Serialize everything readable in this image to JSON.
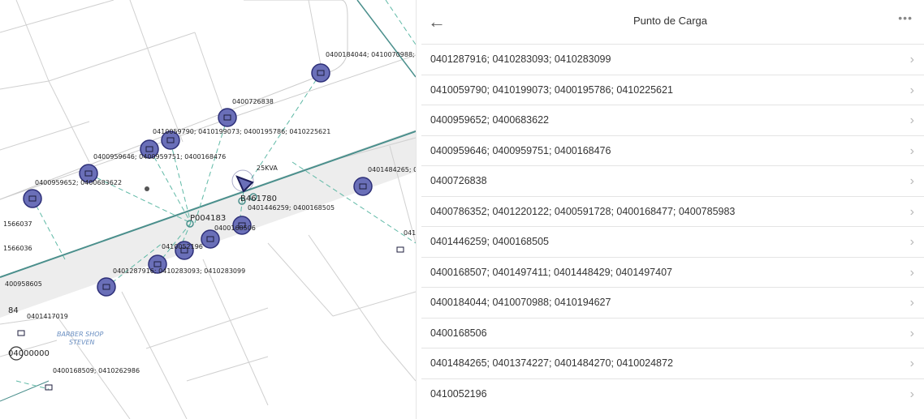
{
  "panel": {
    "title": "Punto de Carga",
    "back_icon": "arrow-left-icon",
    "menu_icon": "more-horizontal-icon",
    "items": [
      "0401287916; 0410283093; 0410283099",
      "0410059790; 0410199073; 0400195786; 0410225621",
      "0400959652; 0400683622",
      "0400959646; 0400959751; 0400168476",
      "0400726838",
      "0400786352; 0401220122; 0400591728; 0400168477; 0400785983",
      "0401446259; 0400168505",
      "0400168507; 0401497411; 0401448429; 0401497407",
      "0400184044; 0410070988; 0410194627",
      "0400168506",
      "0401484265; 0401374227; 0401484270; 0410024872",
      "0410052196"
    ]
  },
  "map": {
    "labels": {
      "l1": "0400184044; 0410070988;",
      "l2": "0400726838",
      "l3": "0410059790; 0410199073; 0400195786; 0410225621",
      "l4": "0400959646; 0400959751; 0400168476",
      "l5": "0400959652; 0400683622",
      "l6": "25KVA",
      "l7": "0401484265; 0",
      "l8": "B461780",
      "l9": "0401446259; 0400168505",
      "l10": "P004183",
      "l11": "0400168506",
      "l12": "1566037",
      "l13": "1566036",
      "l14": "0410052196",
      "l15": "0401287916; 0410283093; 0410283099",
      "l16": "400958605",
      "l17": "84",
      "l18": "0401417019",
      "l19": "BARBER SHOP",
      "l20": "STEVEN",
      "l21": "04000000",
      "l22": "0400168509; 0410262986",
      "l23": "041"
    },
    "colors": {
      "marker_fill": "#6a6fb8",
      "marker_stroke": "#2d2f78",
      "line_teal": "#4a8f8c",
      "street": "#eeeeee"
    }
  }
}
